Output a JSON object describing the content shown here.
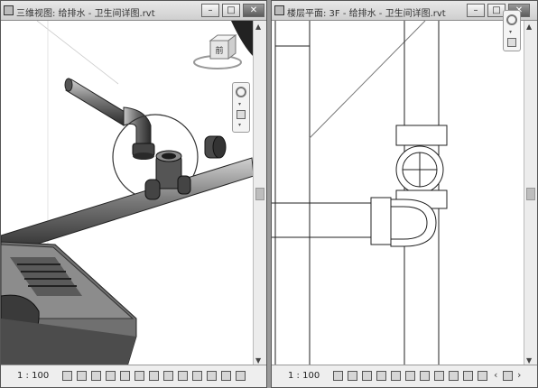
{
  "left_window": {
    "title": "三维视图: 给排水 - 卫生间详图.rvt",
    "view_scale": "1 : 100",
    "cube_face": "前"
  },
  "right_window": {
    "title": "楼层平面: 3F - 给排水 - 卫生间详图.rvt",
    "view_scale": "1 : 100"
  },
  "controls": {
    "minimize": "–",
    "maximize": "□",
    "close": "✕"
  }
}
